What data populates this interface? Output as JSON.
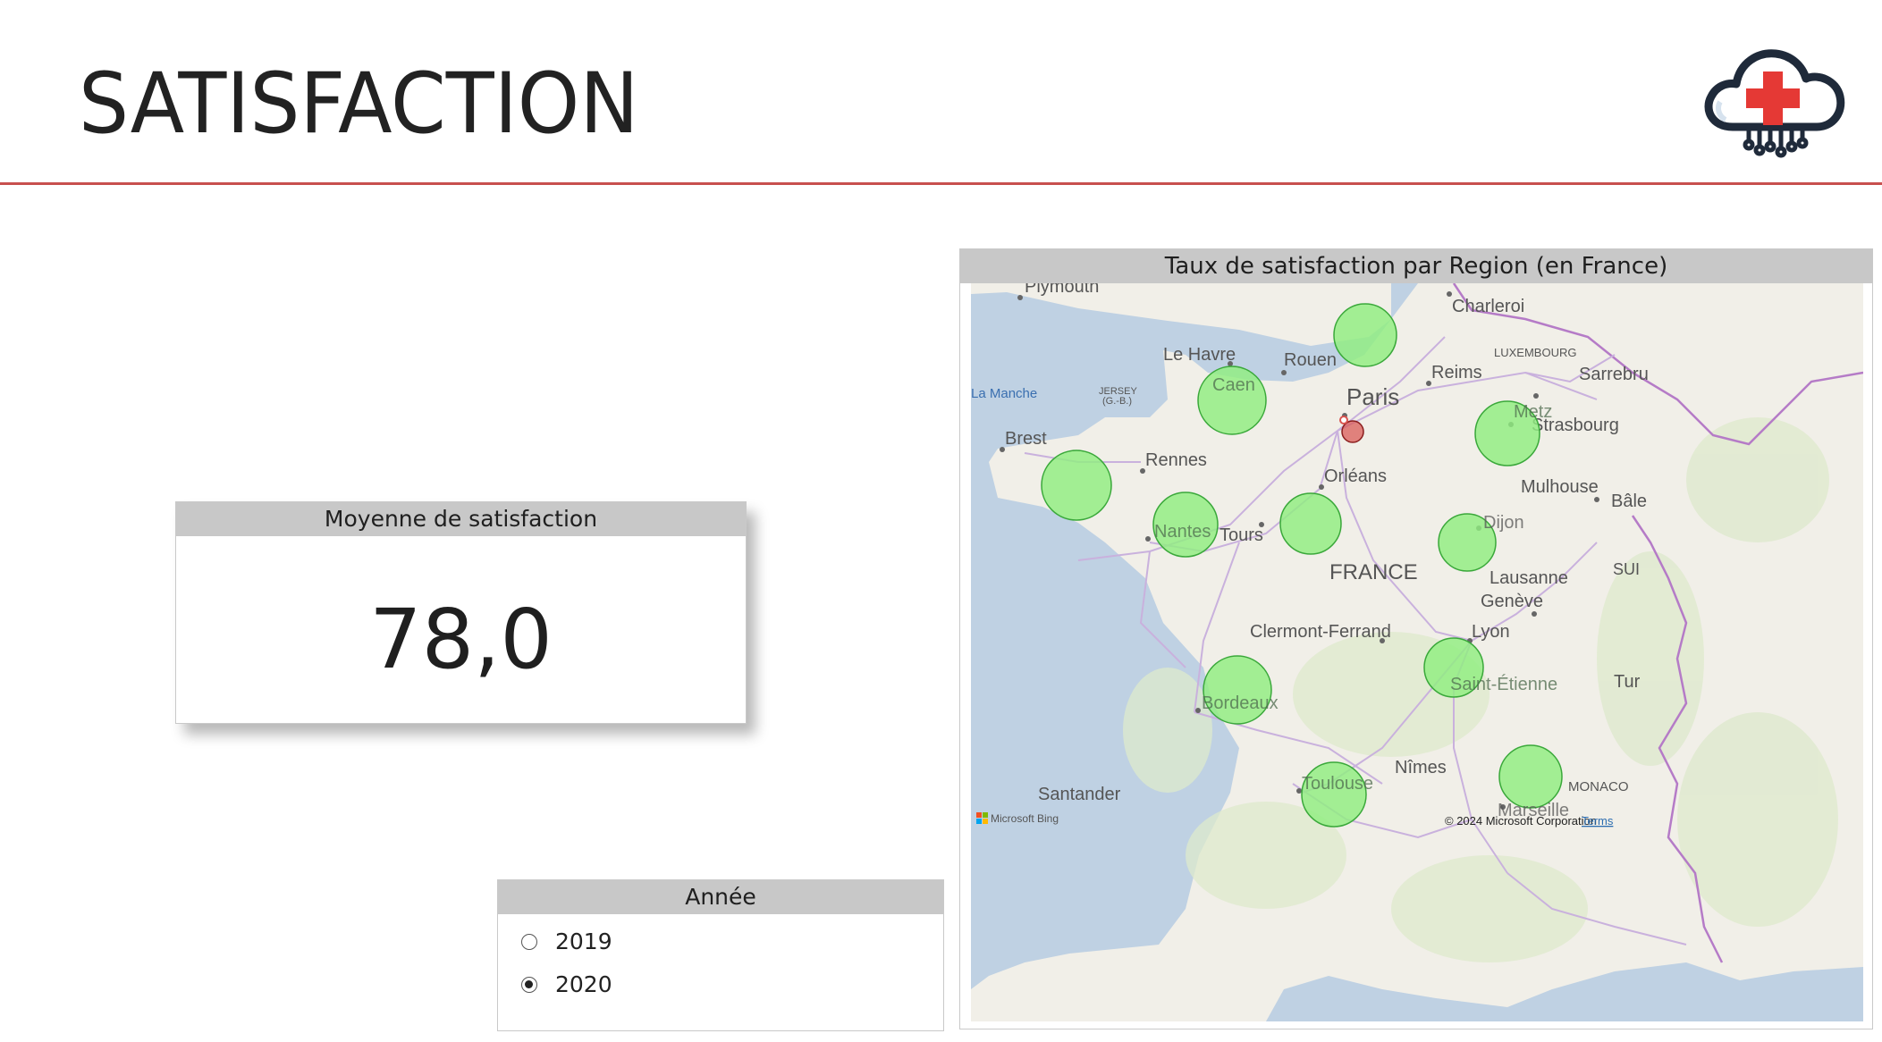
{
  "page": {
    "title": "SATISFACTION"
  },
  "kpi": {
    "header": "Moyenne de satisfaction",
    "value": "78,0"
  },
  "slicer": {
    "header": "Année",
    "options": [
      {
        "label": "2019",
        "selected": false
      },
      {
        "label": "2020",
        "selected": true
      }
    ]
  },
  "map": {
    "header": "Taux de satisfaction par Region (en France)",
    "country_label": "FRANCE",
    "sea_label": "La Manche",
    "city_labels": {
      "plymouth": "Plymouth",
      "charleroi": "Charleroi",
      "le_havre": "Le Havre",
      "rouen": "Rouen",
      "caen": "Caen",
      "jersey": "JERSEY",
      "jersey_sub": "(G.-B.)",
      "paris": "Paris",
      "reims": "Reims",
      "luxembourg": "LUXEMBOURG",
      "sarrebruck": "Sarrebru",
      "metz": "Metz",
      "strasbourg": "Strasbourg",
      "brest": "Brest",
      "rennes": "Rennes",
      "orleans": "Orléans",
      "mulhouse": "Mulhouse",
      "bale": "Bâle",
      "nantes": "Nantes",
      "tours": "Tours",
      "dijon": "Dijon",
      "lausanne": "Lausanne",
      "suisse": "SUI",
      "geneve": "Genève",
      "clermont": "Clermont-Ferrand",
      "lyon": "Lyon",
      "saint_etienne": "Saint-Étienne",
      "turin": "Tur",
      "bordeaux": "Bordeaux",
      "nimes": "Nîmes",
      "monaco": "MONACO",
      "santander": "Santander",
      "toulouse": "Toulouse",
      "marseille": "Marseille"
    },
    "attribution": {
      "provider": "Microsoft Bing",
      "copyright": "© 2024 Microsoft Corporation",
      "terms": "Terms"
    },
    "bubble_color": "#90ee80",
    "highlight_color": "#d9534f"
  },
  "colors": {
    "divider": "#c8504e",
    "header_bg": "#c8c8c8",
    "logo_red": "#e53935",
    "logo_navy": "#1f2a3a"
  }
}
